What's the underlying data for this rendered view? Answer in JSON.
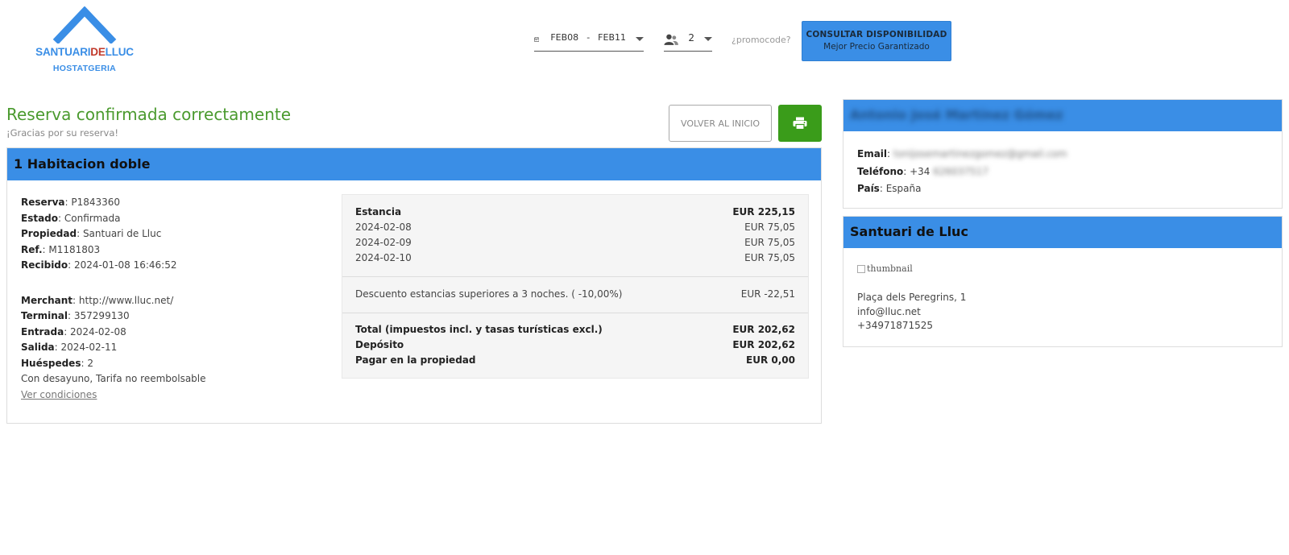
{
  "brand": {
    "name_part1": "SANTUARI",
    "name_part2": "DE",
    "name_part3": "LLUC",
    "subtitle": "HOSTATGERIA",
    "accent_color": "#3a8ee6",
    "red_color": "#c0392b"
  },
  "search": {
    "date_from": "FEB08",
    "date_separator": "-",
    "date_to": "FEB11",
    "guests": "2",
    "promocode_placeholder": "¿promocode?",
    "cta_line1": "CONSULTAR DISPONIBILIDAD",
    "cta_line2": "Mejor Precio Garantizado"
  },
  "confirmation": {
    "title": "Reserva confirmada correctamente",
    "subtitle": "¡Gracias por su reserva!",
    "home_button": "VOLVER AL INICIO",
    "print_icon": "printer-icon",
    "title_color": "#4a9a2e",
    "print_button_color": "#3a9c1a"
  },
  "room": {
    "header": "1  Habitacion doble",
    "details": [
      {
        "label": "Reserva",
        "value": "P1843360"
      },
      {
        "label": "Estado",
        "value": "Confirmada"
      },
      {
        "label": "Propiedad",
        "value": "Santuari de Lluc"
      },
      {
        "label": "Ref.",
        "value": "M1181803"
      },
      {
        "label": "Recibido",
        "value": "2024-01-08 16:46:52"
      }
    ],
    "details2": [
      {
        "label": "Merchant",
        "value": "http://www.lluc.net/"
      },
      {
        "label": "Terminal",
        "value": "357299130"
      },
      {
        "label": "Entrada",
        "value": "2024-02-08"
      },
      {
        "label": "Salida",
        "value": "2024-02-11"
      },
      {
        "label": "Huéspedes",
        "value": "2"
      }
    ],
    "rate_note": "Con desayuno, Tarifa no reembolsable",
    "conditions_link": "Ver condiciones"
  },
  "pricing": {
    "stay_label": "Estancia",
    "stay_total": "EUR 225,15",
    "nights": [
      {
        "date": "2024-02-08",
        "price": "EUR 75,05"
      },
      {
        "date": "2024-02-09",
        "price": "EUR 75,05"
      },
      {
        "date": "2024-02-10",
        "price": "EUR 75,05"
      }
    ],
    "discount_label": "Descuento estancias superiores a 3 noches. ( -10,00%)",
    "discount_value": "EUR -22,51",
    "total_label": "Total (impuestos incl. y tasas turísticas excl.)",
    "total_value": "EUR 202,62",
    "deposit_label": "Depósito",
    "deposit_value": "EUR 202,62",
    "pay_label": "Pagar en la propiedad",
    "pay_value": "EUR 0,00"
  },
  "guest": {
    "name": "Antonio José Martínez Gómez",
    "email_label": "Email",
    "email_value": "tonijosemartinezgomez@gmail.com",
    "phone_label": "Teléfono",
    "phone_prefix": "+34",
    "phone_value": "626037517",
    "country_label": "País",
    "country_value": "España"
  },
  "property": {
    "header": "Santuari de Lluc",
    "thumbnail_alt": "thumbnail",
    "address": "Plaça dels Peregrins, 1",
    "email": "info@lluc.net",
    "phone": "+34971871525"
  }
}
